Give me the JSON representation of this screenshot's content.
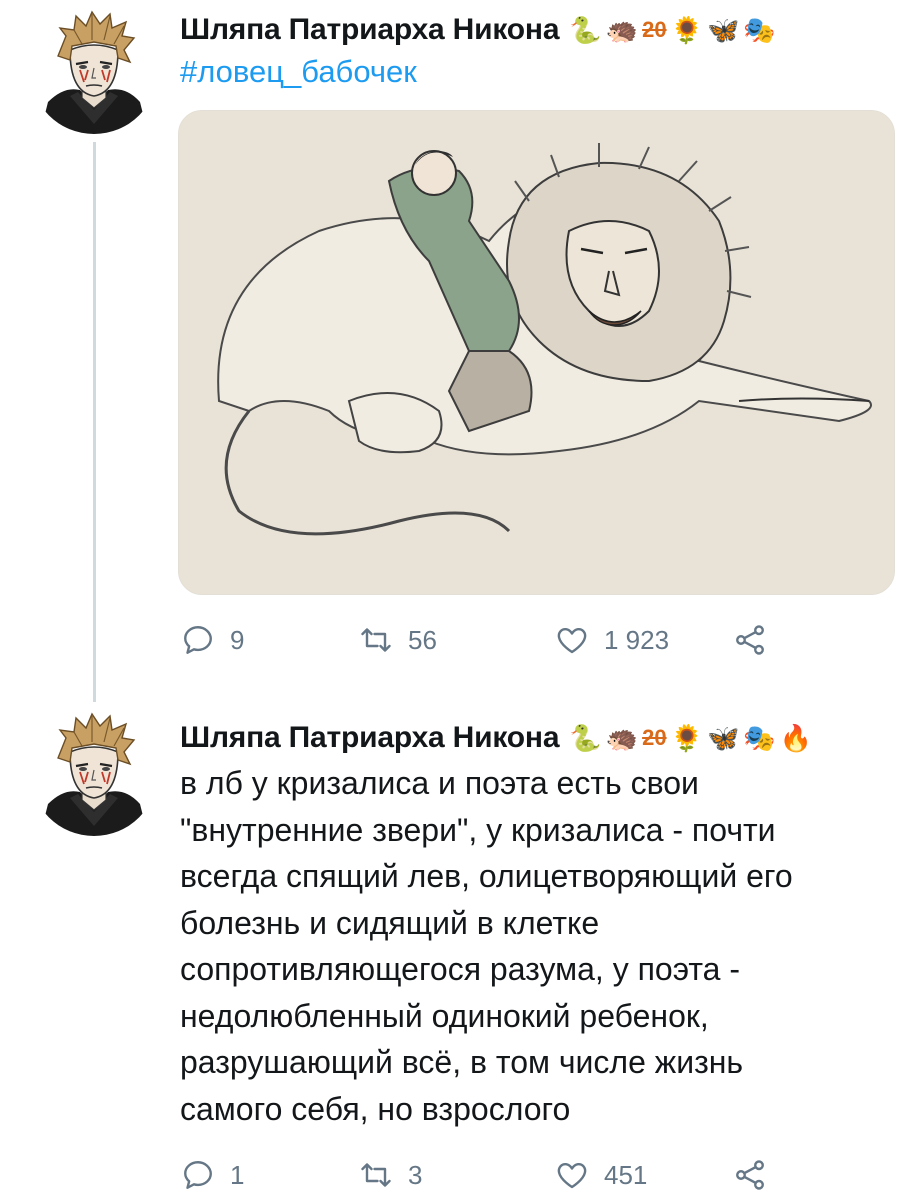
{
  "tweets": [
    {
      "author": {
        "display_name": "Шляпа Патриарха Никона",
        "badges": [
          "snake-emoji",
          "hedgehog-emoji",
          "20-text",
          "sunflower-emoji",
          "butterfly-emoji",
          "theater-masks-emoji"
        ]
      },
      "hashtag": "#ловец_бабочек",
      "text": "",
      "media": {
        "type": "illustration",
        "description_icon": "lion-and-man-drawing"
      },
      "actions": {
        "replies": "9",
        "retweets": "56",
        "likes": "1 923"
      }
    },
    {
      "author": {
        "display_name": "Шляпа Патриарха Никона",
        "badges": [
          "snake-emoji",
          "hedgehog-emoji",
          "20-text",
          "sunflower-emoji",
          "butterfly-emoji",
          "theater-masks-emoji",
          "fire-emoji"
        ]
      },
      "text": "в лб у кризалиса и поэта есть свои\n\"внутренние звери\", у кризалиса - почти\nвсегда спящий лев, олицетворяющий его\nболезнь и сидящий в клетке\nсопротивляющегося разума, у поэта -\nнедолюбленный одинокий ребенок,\nразрушающий всё, в том числе жизнь\nсамого себя, но взрослого",
      "actions": {
        "replies": "1",
        "retweets": "3",
        "likes": "451"
      }
    }
  ],
  "badge_text": "20",
  "colors": {
    "link": "#1d9bf0",
    "icon_gray": "#657786",
    "thread_line": "#cfd9de",
    "media_bg": "#e9e3d7"
  }
}
